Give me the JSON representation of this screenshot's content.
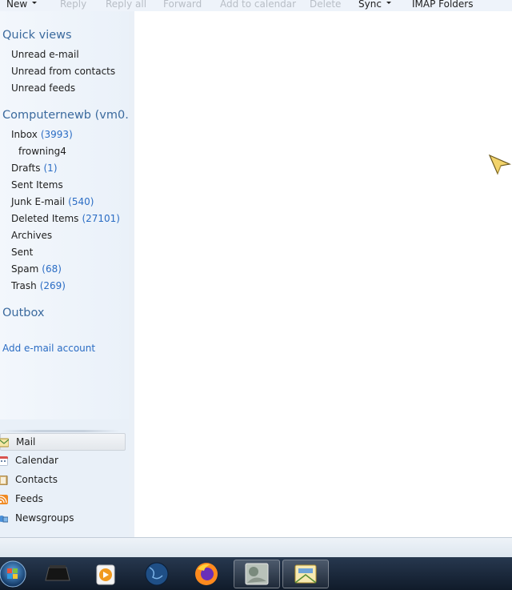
{
  "toolbar": {
    "new": "New",
    "reply": "Reply",
    "reply_all": "Reply all",
    "forward": "Forward",
    "add_to_calendar": "Add to calendar",
    "delete": "Delete",
    "sync": "Sync",
    "imap_folders": "IMAP Folders"
  },
  "quick_views": {
    "title": "Quick views",
    "items": [
      "Unread e-mail",
      "Unread from contacts",
      "Unread feeds"
    ]
  },
  "account": {
    "title": "Computernewb (vm0...",
    "folders": [
      {
        "name": "Inbox",
        "count": "(3993)"
      },
      {
        "name": "frowning4",
        "count": ""
      },
      {
        "name": "Drafts",
        "count": "(1)"
      },
      {
        "name": "Sent Items",
        "count": ""
      },
      {
        "name": "Junk E-mail",
        "count": "(540)"
      },
      {
        "name": "Deleted Items",
        "count": "(27101)"
      },
      {
        "name": "Archives",
        "count": ""
      },
      {
        "name": "Sent",
        "count": ""
      },
      {
        "name": "Spam",
        "count": "(68)"
      },
      {
        "name": "Trash",
        "count": "(269)"
      }
    ]
  },
  "outbox": {
    "title": "Outbox"
  },
  "add_account": {
    "label": "Add e-mail account"
  },
  "bottom_nav": [
    "Mail",
    "Calendar",
    "Contacts",
    "Feeds",
    "Newsgroups"
  ],
  "taskbar": {
    "apps": [
      "start-orb",
      "desktop-app",
      "media-player",
      "globe-browser",
      "firefox",
      "photo-app",
      "windows-live-mail"
    ]
  },
  "colors": {
    "accent_link": "#2a6cc4",
    "section_head": "#3b6a9e",
    "disabled_text": "#b8bec6",
    "taskbar": "#1a2738"
  }
}
